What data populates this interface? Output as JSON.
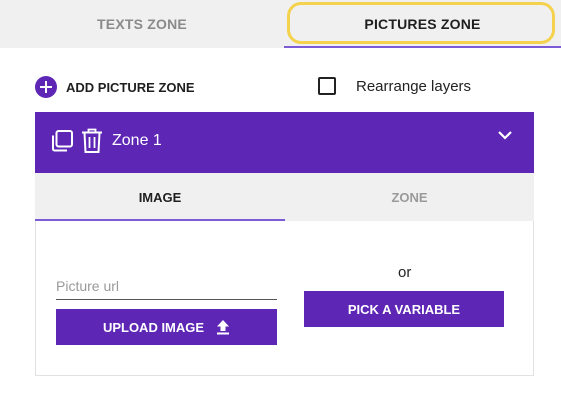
{
  "tabs": {
    "texts_label": "TEXTS ZONE",
    "pictures_label": "PICTURES ZONE",
    "active": "pictures"
  },
  "toolbar": {
    "add_picture_zone_label": "ADD PICTURE ZONE",
    "rearrange_label": "Rearrange layers",
    "rearrange_checked": false
  },
  "zone": {
    "title": "Zone 1",
    "tabs": {
      "image_label": "IMAGE",
      "zone_label": "ZONE",
      "active": "image"
    },
    "picture_url": {
      "value": "",
      "placeholder": "Picture url"
    },
    "upload_label": "UPLOAD IMAGE",
    "or_label": "or",
    "pick_variable_label": "PICK A VARIABLE"
  },
  "colors": {
    "accent": "#5e26b5",
    "tab_underline": "#7b5cd6",
    "highlight_ring": "#f5d24d",
    "tab_bar_bg": "#f0f0f0"
  },
  "icons": [
    "plus-icon",
    "checkbox",
    "copy-icon",
    "trash-icon",
    "chevron-down-icon",
    "upload-icon"
  ]
}
